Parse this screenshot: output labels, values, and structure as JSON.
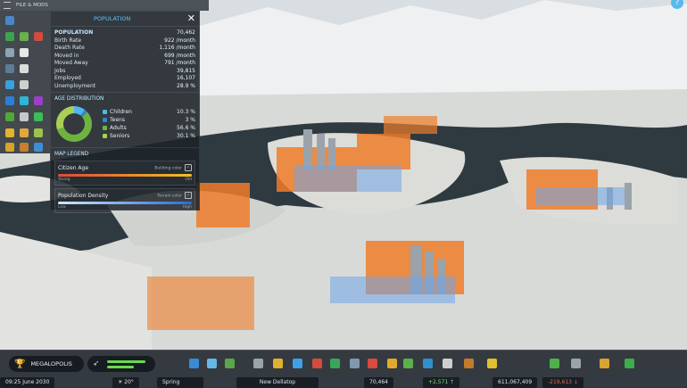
{
  "topbar": {
    "label": "FILE & MODS"
  },
  "panel": {
    "title": "POPULATION",
    "close": "✕",
    "stats_heading": "POPULATION",
    "total": "70,462",
    "rows": [
      {
        "label": "Birth Rate",
        "value": "922 /month"
      },
      {
        "label": "Death Rate",
        "value": "1,116 /month"
      },
      {
        "label": "Moved in",
        "value": "699 /month"
      },
      {
        "label": "Moved Away",
        "value": "791 /month"
      },
      {
        "label": "Jobs",
        "value": "39,815"
      },
      {
        "label": "Employed",
        "value": "16,107"
      },
      {
        "label": "Unemployment",
        "value": "28.9 %"
      }
    ],
    "age_heading": "AGE DISTRIBUTION",
    "age": [
      {
        "label": "Children",
        "value": "10.3 %",
        "color": "#4fb6ee",
        "share": 10.3
      },
      {
        "label": "Teens",
        "value": "3 %",
        "color": "#2f85d0",
        "share": 3.0
      },
      {
        "label": "Adults",
        "value": "56.6 %",
        "color": "#6fb33f",
        "share": 56.6
      },
      {
        "label": "Seniors",
        "value": "30.1 %",
        "color": "#a9cf56",
        "share": 30.1
      }
    ],
    "legend_heading": "MAP LEGEND",
    "legend": [
      {
        "label": "Citizen Age",
        "tag": "Building color",
        "low": "Young",
        "high": "Old",
        "from": "#e0483a",
        "to": "#f0c21e"
      },
      {
        "label": "Population Density",
        "tag": "Terrain color",
        "low": "Low",
        "high": "High",
        "from": "#cfe6ff",
        "to": "#2a6bd6"
      }
    ]
  },
  "help": "?",
  "bottom": {
    "milestone": "MEGALOPOLIS",
    "progress": [
      0.9,
      0.62
    ],
    "strip": {
      "time": "09:25  June 2030",
      "weather": "☀ 20°",
      "season": "Spring",
      "city": "New Dellatop",
      "population": "70,464",
      "pop_change": "+2,571 ↑",
      "money": "611,067,409",
      "money_change": "-219,613 ↓"
    }
  }
}
